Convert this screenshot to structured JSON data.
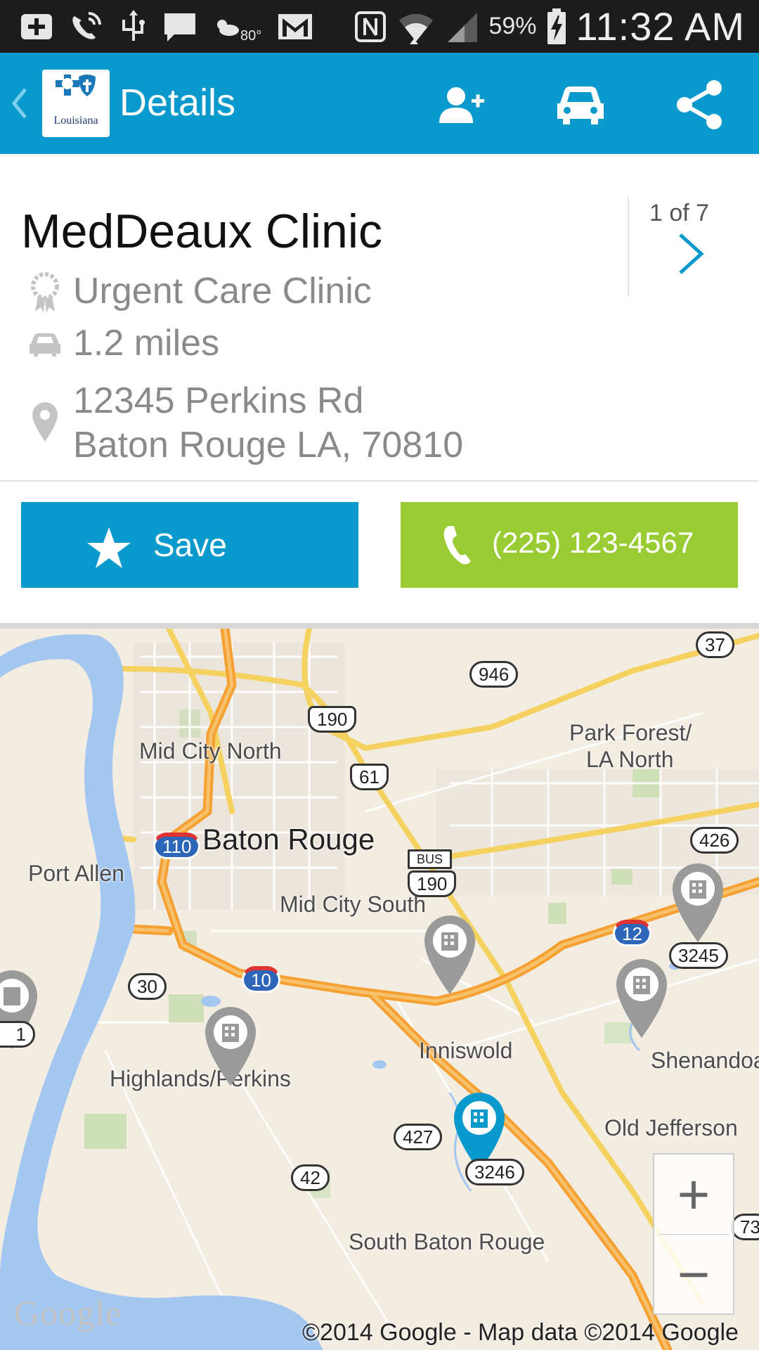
{
  "status_bar": {
    "temperature": "80°",
    "battery": "59%",
    "time": "11:32 AM"
  },
  "app_bar": {
    "title": "Details",
    "logo_text": "Louisiana",
    "color": "#0999cc"
  },
  "detail": {
    "name": "MedDeaux Clinic",
    "type": "Urgent Care Clinic",
    "distance": "1.2 miles",
    "address_line1": "12345 Perkins Rd",
    "address_line2": "Baton Rouge LA, 70810",
    "pager": "1 of 7"
  },
  "actions": {
    "save_label": "Save",
    "phone_label": "(225) 123-4567",
    "save_color": "#0999cc",
    "phone_color": "#99cc33"
  },
  "map": {
    "labels": {
      "mid_city_north": "Mid City North",
      "baton_rouge": "Baton Rouge",
      "port_allen": "Port Allen",
      "mid_city_south": "Mid City South",
      "park_forest_1": "Park Forest/",
      "park_forest_2": "LA North",
      "inniswold": "Inniswold",
      "highlands_perkins": "Highlands/Perkins",
      "shenandoah": "Shenandoa",
      "old_jefferson": "Old Jefferson",
      "south_baton_rouge": "South Baton Rouge"
    },
    "routes": {
      "r946": "946",
      "r37": "37",
      "r190_top": "190",
      "r61": "61",
      "r110": "110",
      "bus": "BUS",
      "r190_bus": "190",
      "r426": "426",
      "r12": "12",
      "r10": "10",
      "r30": "30",
      "r427": "427",
      "r42": "42",
      "r73": "73"
    },
    "pin_labels": {
      "p3245": "3245",
      "p3246": "3246",
      "left_partial": "1"
    },
    "zoom_in": "+",
    "zoom_out": "−",
    "logo": "Google",
    "copyright": "©2014 Google - Map data ©2014 Google"
  }
}
